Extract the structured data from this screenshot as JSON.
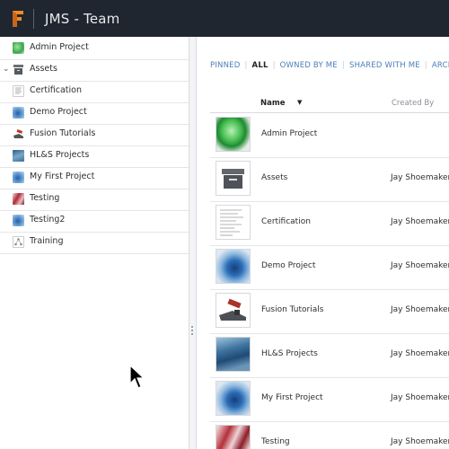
{
  "app": {
    "title": "JMS - Team"
  },
  "sidebar": {
    "items": [
      {
        "label": "Admin Project",
        "icon": "green-swirl-thumb"
      },
      {
        "label": "Assets",
        "icon": "archive-box-thumb",
        "expandable": true
      },
      {
        "label": "Certification",
        "icon": "document-thumb"
      },
      {
        "label": "Demo Project",
        "icon": "blue-swirl-thumb"
      },
      {
        "label": "Fusion Tutorials",
        "icon": "clamp-thumb"
      },
      {
        "label": "HL&S Projects",
        "icon": "blue-fabric-thumb"
      },
      {
        "label": "My First Project",
        "icon": "blue-swirl-thumb"
      },
      {
        "label": "Testing",
        "icon": "red-ribbons-thumb"
      },
      {
        "label": "Testing2",
        "icon": "blue-swirl-thumb"
      },
      {
        "label": "Training",
        "icon": "network-thumb"
      }
    ]
  },
  "filters": {
    "items": [
      "PINNED",
      "ALL",
      "OWNED BY ME",
      "SHARED WITH ME",
      "ARCHIV"
    ],
    "active": "ALL"
  },
  "table": {
    "col_name": "Name",
    "col_created": "Created By",
    "rows": [
      {
        "name": "Admin Project",
        "created_by": ""
      },
      {
        "name": "Assets",
        "created_by": "Jay Shoemaker"
      },
      {
        "name": "Certification",
        "created_by": "Jay Shoemaker"
      },
      {
        "name": "Demo Project",
        "created_by": "Jay Shoemaker"
      },
      {
        "name": "Fusion Tutorials",
        "created_by": "Jay Shoemaker"
      },
      {
        "name": "HL&S Projects",
        "created_by": "Jay Shoemaker"
      },
      {
        "name": "My First Project",
        "created_by": "Jay Shoemaker"
      },
      {
        "name": "Testing",
        "created_by": "Jay Shoemaker"
      }
    ]
  },
  "colors": {
    "topbar": "#1f2630",
    "accent": "#4a7fb5",
    "logo": "#f08a24"
  }
}
